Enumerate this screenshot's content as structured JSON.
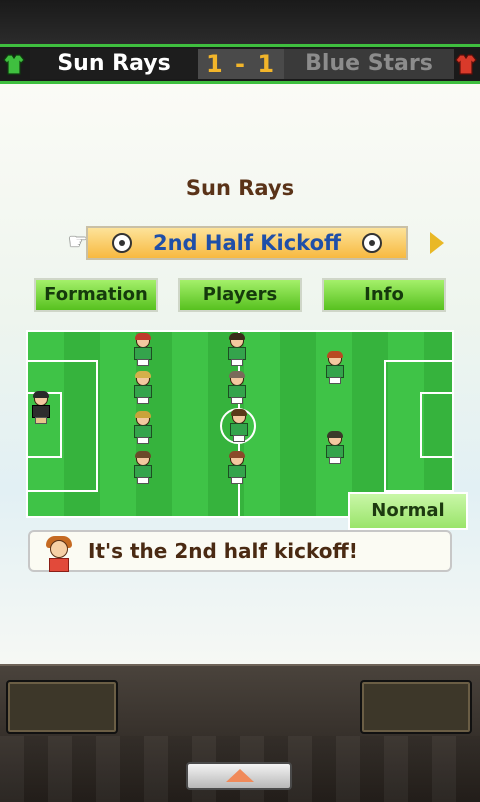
{
  "scoreboard": {
    "home_team": "Sun Rays",
    "away_team": "Blue Stars",
    "score": "1 - 1",
    "home_color": "#3fbf3f",
    "away_color": "#d93a2a",
    "home_icon": "green-jersey-icon",
    "away_icon": "red-jersey-icon"
  },
  "match": {
    "team_title": "Sun Rays",
    "phase": "2nd Half Kickoff",
    "pointer_icon": "pointing-hand-icon",
    "next_icon": "arrow-right-icon"
  },
  "tabs": {
    "formation": "Formation",
    "players": "Players",
    "info": "Info"
  },
  "speed": {
    "label": "Normal"
  },
  "message": {
    "text": "It's the 2nd half kickoff!",
    "avatar_icon": "coach-avatar-icon"
  },
  "footer": {
    "expand_icon": "arrow-up-icon"
  }
}
